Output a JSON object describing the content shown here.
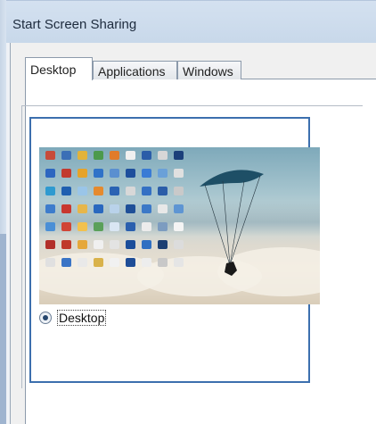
{
  "window": {
    "title": "Start Screen Sharing"
  },
  "tabs": [
    {
      "label": "Desktop",
      "active": true
    },
    {
      "label": "Applications",
      "active": false
    },
    {
      "label": "Windows",
      "active": false
    }
  ],
  "desktop_option": {
    "label": "Desktop",
    "selected": true
  },
  "colors": {
    "accent_border": "#3c6fae",
    "titlebar": "#d4e1f0"
  }
}
